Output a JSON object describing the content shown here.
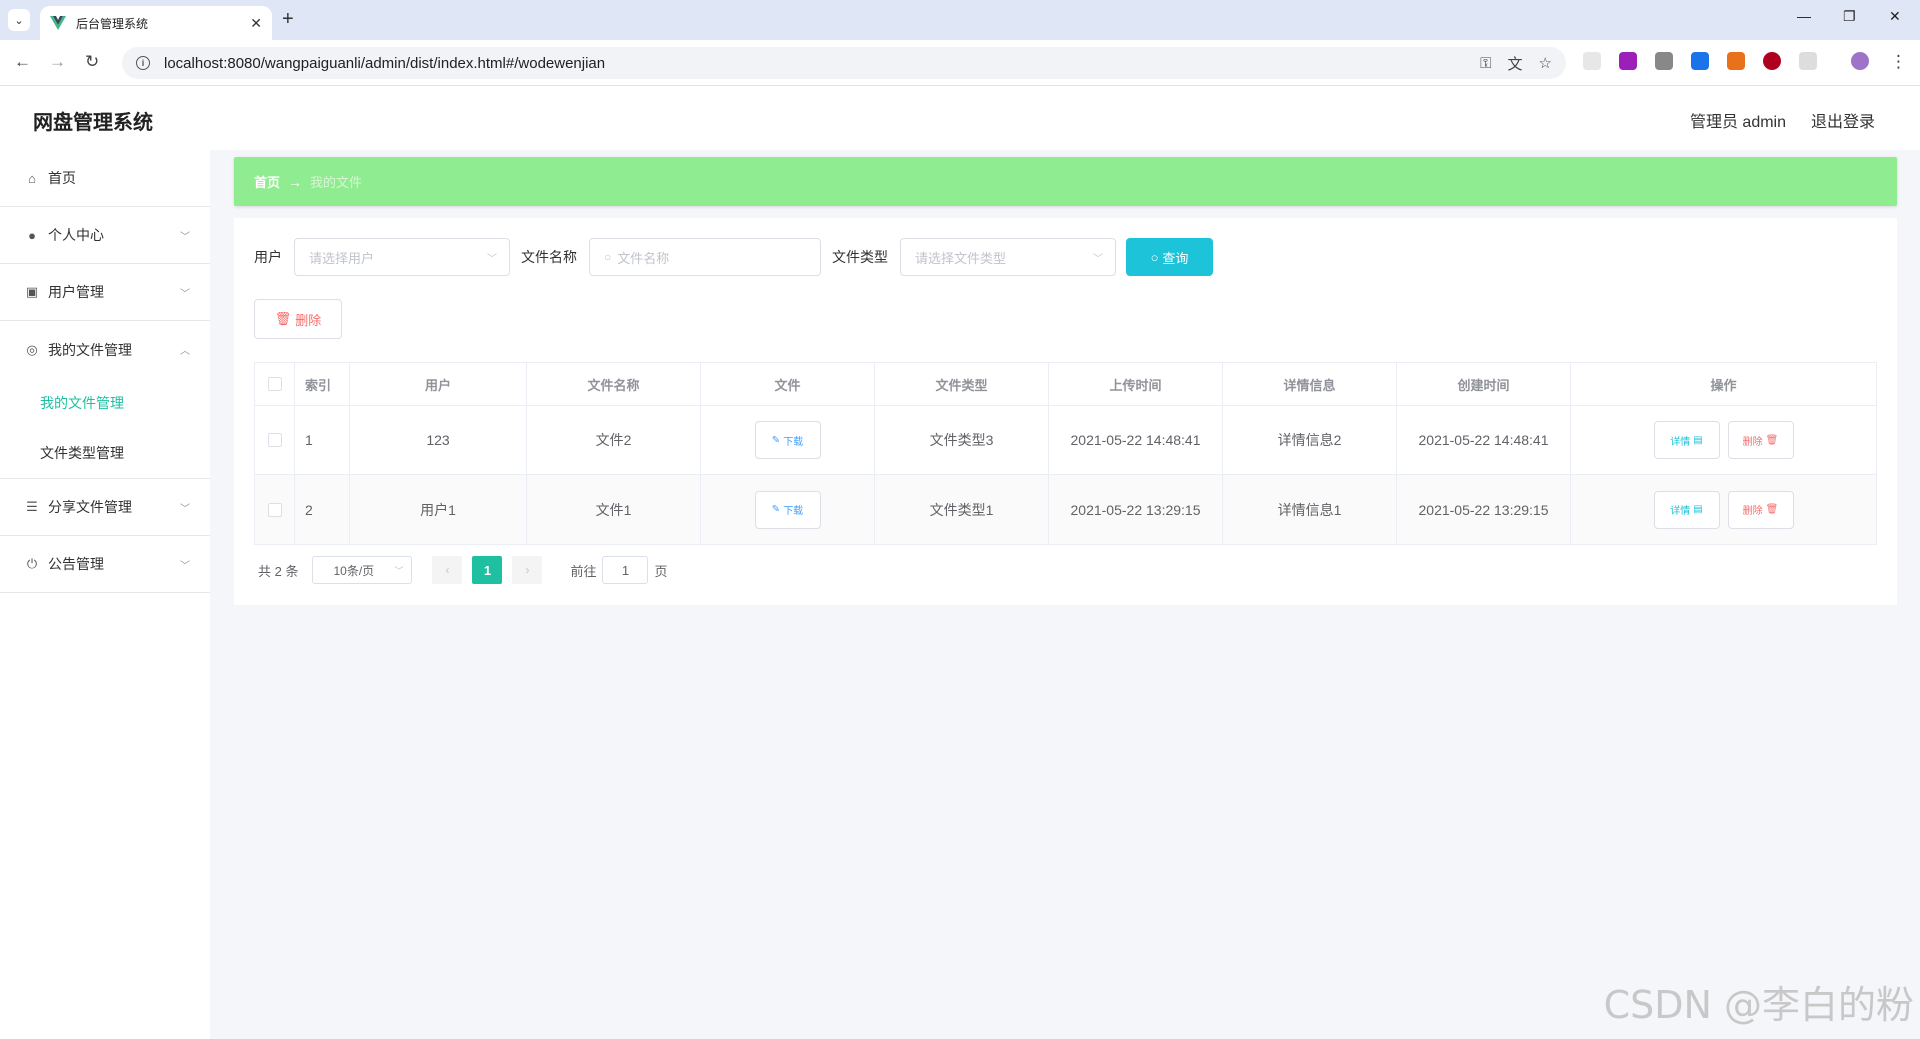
{
  "browser": {
    "tab_title": "后台管理系统",
    "url": "localhost:8080/wangpaiguanli/admin/dist/index.html#/wodewenjian"
  },
  "header": {
    "app_title": "网盘管理系统",
    "user_label": "管理员 admin",
    "logout_label": "退出登录"
  },
  "sidebar": {
    "items": [
      {
        "label": "首页",
        "icon": "home-icon"
      },
      {
        "label": "个人中心",
        "icon": "user-icon"
      },
      {
        "label": "用户管理",
        "icon": "clipboard-icon"
      },
      {
        "label": "我的文件管理",
        "icon": "compass-icon"
      },
      {
        "label": "分享文件管理",
        "icon": "list-icon"
      },
      {
        "label": "公告管理",
        "icon": "power-icon"
      }
    ],
    "submenu": [
      {
        "label": "我的文件管理",
        "active": true
      },
      {
        "label": "文件类型管理",
        "active": false
      }
    ]
  },
  "breadcrumb": {
    "home": "首页",
    "arrow": "→",
    "current": "我的文件"
  },
  "filters": {
    "user_label": "用户",
    "user_placeholder": "请选择用户",
    "name_label": "文件名称",
    "name_placeholder": "文件名称",
    "type_label": "文件类型",
    "type_placeholder": "请选择文件类型",
    "query_label": "查询"
  },
  "actions": {
    "delete_label": "删除"
  },
  "table": {
    "headers": [
      "索引",
      "用户",
      "文件名称",
      "文件",
      "文件类型",
      "上传时间",
      "详情信息",
      "创建时间",
      "操作"
    ],
    "rows": [
      {
        "index": "1",
        "user": "123",
        "name": "文件2",
        "file_btn": "下载",
        "type": "文件类型3",
        "upload_time": "2021-05-22 14:48:41",
        "detail": "详情信息2",
        "create_time": "2021-05-22 14:48:41",
        "detail_btn": "详情",
        "delete_btn": "删除"
      },
      {
        "index": "2",
        "user": "用户1",
        "name": "文件1",
        "file_btn": "下载",
        "type": "文件类型1",
        "upload_time": "2021-05-22 13:29:15",
        "detail": "详情信息1",
        "create_time": "2021-05-22 13:29:15",
        "detail_btn": "详情",
        "delete_btn": "删除"
      }
    ]
  },
  "pagination": {
    "total": "共 2 条",
    "page_size": "10条/页",
    "current_page": "1",
    "goto_label": "前往",
    "goto_value": "1",
    "page_suffix": "页"
  },
  "watermark": "CSDN @李白的粉"
}
